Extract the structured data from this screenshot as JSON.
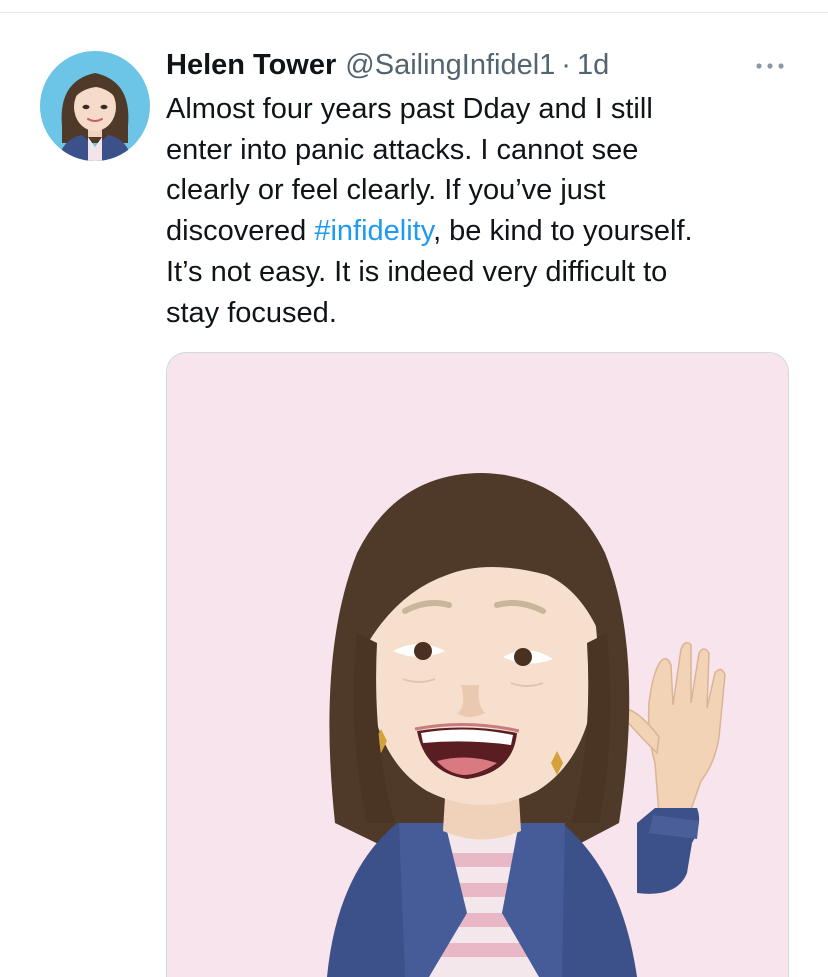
{
  "tweet": {
    "author": {
      "display_name": "Helen Tower",
      "handle": "@SailingInfidel1",
      "avatar_icon": "memoji-avatar"
    },
    "separator": "·",
    "timestamp": "1d",
    "more_icon": "more-dots-icon",
    "text": {
      "line1": "Almost four years past Dday and I still",
      "line2": "enter into panic attacks. I cannot see",
      "line3": "clearly or feel clearly. If you’ve just",
      "line4_before": "discovered ",
      "hashtag": "#infidelity",
      "line4_after": ", be kind to yourself.",
      "line5": "It’s not easy. It is indeed very difficult to",
      "line6": "stay focused."
    },
    "media": {
      "type": "image",
      "subject": "memoji-waving"
    }
  },
  "colors": {
    "text": "#0f1419",
    "secondary": "#536471",
    "link": "#1d9bf0",
    "media_background": "#f7e4ec",
    "avatar_background": "#6cc4e6",
    "hair": "#4f3a2a",
    "jacket": "#3c5089"
  }
}
